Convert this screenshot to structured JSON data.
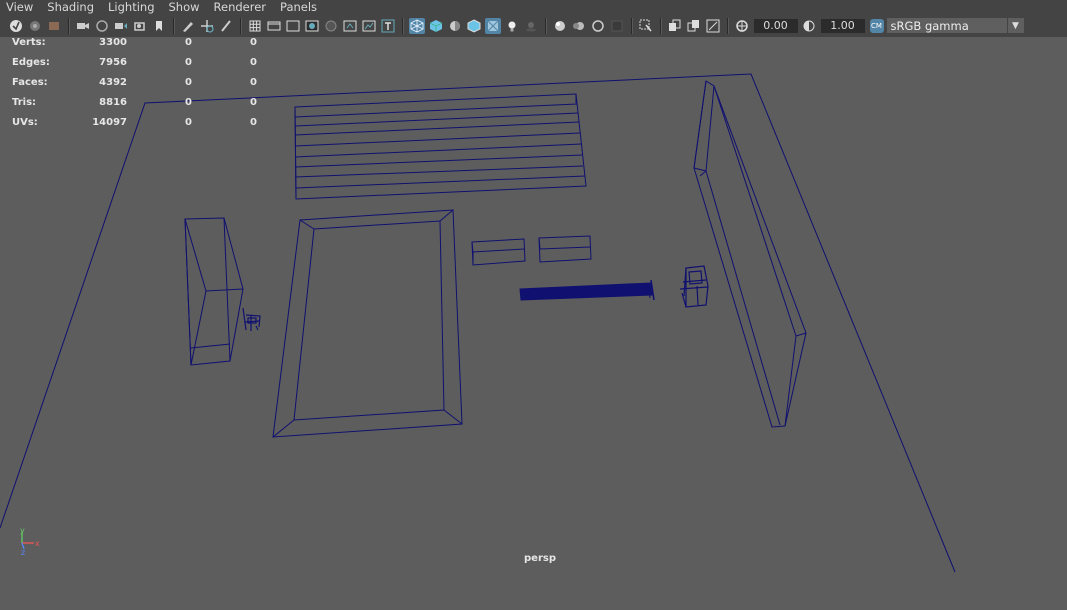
{
  "menu": {
    "items": [
      {
        "label": "View"
      },
      {
        "label": "Shading"
      },
      {
        "label": "Lighting"
      },
      {
        "label": "Show"
      },
      {
        "label": "Renderer"
      },
      {
        "label": "Panels"
      }
    ]
  },
  "toolbar": {
    "exposure_value": "0.00",
    "gamma_value": "1.00",
    "color_management_badge": "CM",
    "color_space": "sRGB gamma",
    "accent_color": "#5285a6"
  },
  "hud": {
    "rows": [
      {
        "label": "Verts:",
        "values": [
          "3300",
          "0",
          "0"
        ]
      },
      {
        "label": "Edges:",
        "values": [
          "7956",
          "0",
          "0"
        ]
      },
      {
        "label": "Faces:",
        "values": [
          "4392",
          "0",
          "0"
        ]
      },
      {
        "label": "Tris:",
        "values": [
          "8816",
          "0",
          "0"
        ]
      },
      {
        "label": "UVs:",
        "values": [
          "14097",
          "0",
          "0"
        ]
      }
    ]
  },
  "viewport": {
    "camera": "persp",
    "background_color": "#5d5d5d",
    "wireframe_color": "#101070",
    "axis_labels": {
      "x": "x",
      "y": "y",
      "z": "z"
    }
  }
}
